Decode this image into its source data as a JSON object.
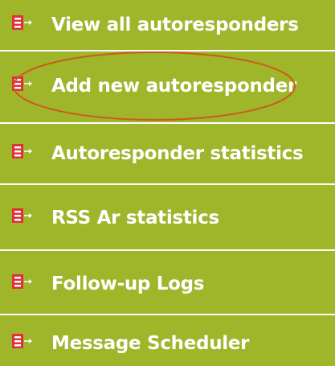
{
  "menu": {
    "items": [
      {
        "label": "View all autoresponders",
        "icon": "menu-arrow-icon"
      },
      {
        "label": "Add new autoresponder",
        "icon": "menu-arrow-icon"
      },
      {
        "label": "Autoresponder statistics",
        "icon": "menu-arrow-icon"
      },
      {
        "label": "RSS Ar statistics",
        "icon": "menu-arrow-icon"
      },
      {
        "label": "Follow-up Logs",
        "icon": "menu-arrow-icon"
      },
      {
        "label": "Message Scheduler",
        "icon": "menu-arrow-icon"
      }
    ]
  },
  "colors": {
    "item_background": "#9fb52a",
    "item_text": "#ffffff",
    "separator": "#ffffff",
    "icon_fill": "#e0303a",
    "highlight_ring": "#cc5a1e"
  },
  "highlight": {
    "target": "Add new autoresponder",
    "shape": "ellipse"
  }
}
